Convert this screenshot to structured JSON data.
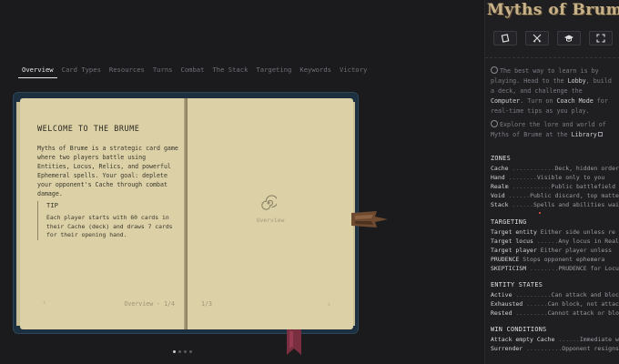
{
  "tabs": [
    {
      "label": "Overview",
      "active": true
    },
    {
      "label": "Card Types",
      "active": false
    },
    {
      "label": "Resources",
      "active": false
    },
    {
      "label": "Turns",
      "active": false
    },
    {
      "label": "Combat",
      "active": false
    },
    {
      "label": "The Stack",
      "active": false
    },
    {
      "label": "Targeting",
      "active": false
    },
    {
      "label": "Keywords",
      "active": false
    },
    {
      "label": "Victory",
      "active": false
    }
  ],
  "book": {
    "left_page": {
      "title": "WELCOME TO THE BRUME",
      "body": "Myths of Brume is a strategic card game where two players battle using Entities, Locus, Relics, and powerful Ephemeral spells. Your goal: deplete your opponent's Cache through combat damage.",
      "tip_title": "TIP",
      "tip_body": "Each player starts with 60 cards in their Cache (deck) and draws 7 cards for their opening hand.",
      "footer": "Overview - 1/4",
      "prev_glyph": "‹"
    },
    "right_page": {
      "label": "Overview",
      "count": "1/3",
      "next_glyph": "›"
    }
  },
  "pager": {
    "total": 4,
    "current": 1
  },
  "sidebar": {
    "logo": "Myths of Brume",
    "tools": [
      "card-icon",
      "swords-icon",
      "graduation-cap-icon",
      "fullscreen-icon"
    ],
    "intro": {
      "p1_a": "The best way to learn is by playing. Head to the ",
      "p1_lobby": "Lobby",
      "p1_b": ", build a deck, and challenge the ",
      "p1_computer": "Computer",
      "p1_c": ". Turn on ",
      "p1_coach": "Coach Mode",
      "p1_d": " for real-time tips as you play.",
      "p2_a": "Explore the lore and world of Myths of Brume at the ",
      "p2_library": "Library"
    },
    "sections": [
      {
        "title": "ZONES",
        "rows": [
          {
            "k": "Cache",
            "d": " ............",
            "v": "Deck, hidden order"
          },
          {
            "k": "Hand",
            "d": " ........",
            "v": "Visible only to you"
          },
          {
            "k": "Realm",
            "d": " ...........",
            "v": "Public battlefield"
          },
          {
            "k": "Void",
            "d": " ......",
            "v": "Public discard, top matters"
          },
          {
            "k": "Stack",
            "d": " ......",
            "v": "Spells and abilities waiting"
          }
        ]
      },
      {
        "title": "TARGETING",
        "rows": [
          {
            "k": "Target entity",
            "d": "",
            "v": " Either side unless re"
          },
          {
            "k": "Target locus",
            "d": " ......",
            "v": "Any locus in Realm"
          },
          {
            "k": "Target player",
            "d": "",
            "v": " Either player unless"
          },
          {
            "k": "PRUDENCE",
            "d": "",
            "v": " Stops opponent ephemera"
          },
          {
            "k": "SKEPTICISM",
            "d": " ........",
            "v": "PRUDENCE for Locus"
          }
        ]
      },
      {
        "title": "ENTITY STATES",
        "rows": [
          {
            "k": "Active",
            "d": " ..........",
            "v": "Can attack and block"
          },
          {
            "k": "Exhausted",
            "d": " ......",
            "v": "Can block, not attack"
          },
          {
            "k": "Rested",
            "d": " .........",
            "v": "Cannot attack or block"
          }
        ]
      },
      {
        "title": "WIN CONDITIONS",
        "rows": [
          {
            "k": "Attack empty Cache",
            "d": " ......",
            "v": "Immediate win"
          },
          {
            "k": "Surrender",
            "d": " ..........",
            "v": "Opponent resigns"
          }
        ]
      }
    ]
  }
}
